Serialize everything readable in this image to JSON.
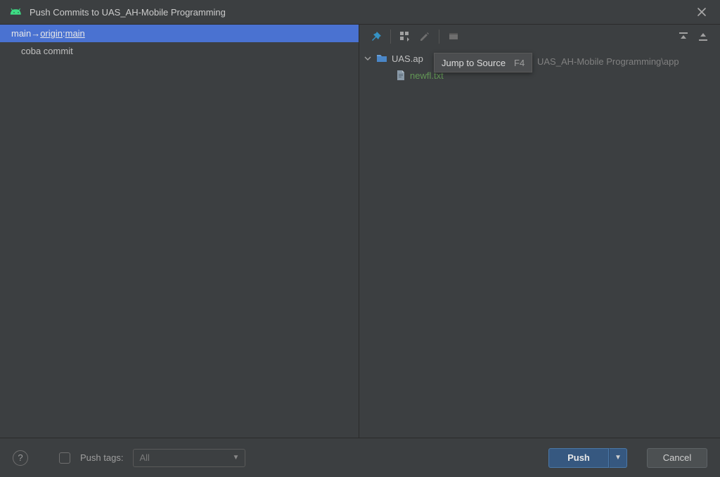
{
  "title": "Push Commits to UAS_AH-Mobile Programming",
  "left": {
    "branch": {
      "local": "main",
      "arrow": " → ",
      "remote": "origin",
      "sep": " : ",
      "remote_branch": "main"
    },
    "commits": [
      "coba commit"
    ]
  },
  "right": {
    "folder": {
      "name": "UAS.ap",
      "suffix": "UAS_AH-Mobile Programming\\app"
    },
    "files": [
      "newfl.txt"
    ]
  },
  "tooltip": {
    "text": "Jump to Source",
    "shortcut": "F4"
  },
  "bottom": {
    "push_tags_label": "Push tags:",
    "push_tags_value": "All",
    "push_label": "Push",
    "cancel_label": "Cancel",
    "help_label": "?"
  },
  "icons": {
    "pin": "pin-icon",
    "group": "group-by-icon",
    "edit": "edit-icon",
    "view": "view-icon",
    "expand": "expand-all-icon",
    "collapse": "collapse-all-icon"
  }
}
